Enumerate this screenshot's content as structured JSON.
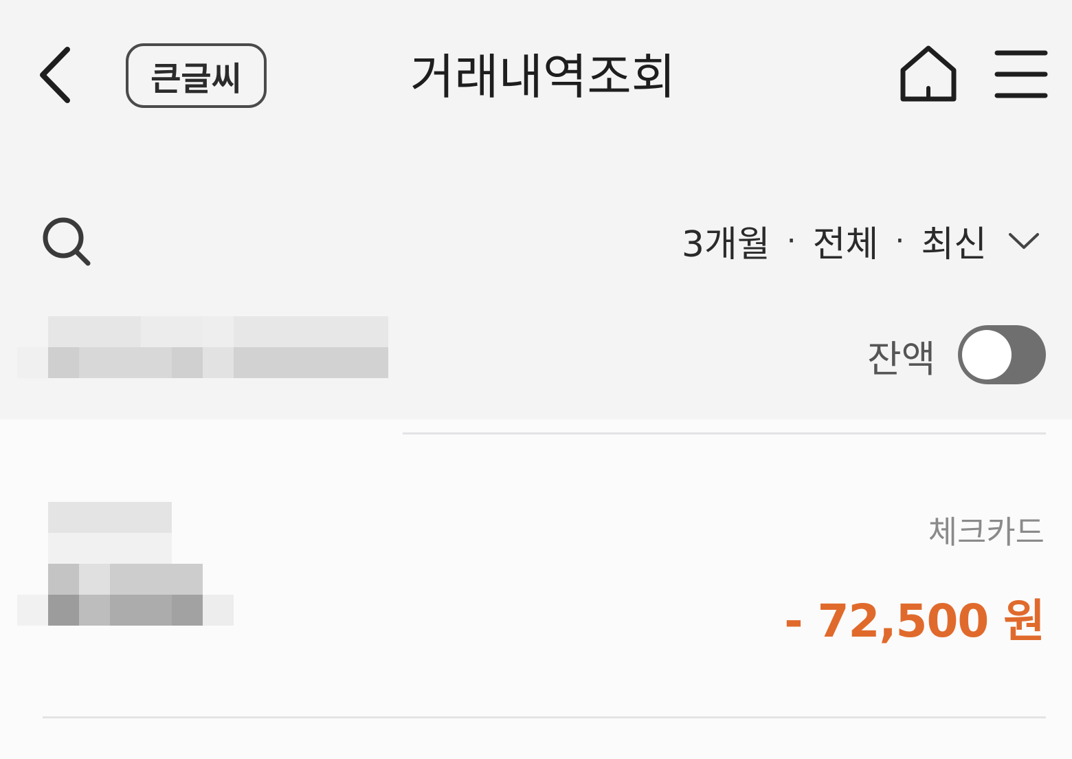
{
  "header": {
    "title": "거래내역조회",
    "bigfont_label": "큰글씨",
    "back_icon": "chevron-left-icon",
    "home_icon": "home-icon",
    "menu_icon": "hamburger-menu-icon"
  },
  "filter": {
    "search_icon": "search-icon",
    "period": "3개월",
    "type": "전체",
    "order": "최신",
    "separator": "·",
    "dropdown_icon": "chevron-down-icon"
  },
  "account": {
    "masked": true,
    "balance_label": "잔액",
    "balance_toggle_on": false
  },
  "transactions": [
    {
      "masked_description": true,
      "type": "체크카드",
      "amount": "- 72,500 원",
      "amount_color": "#e06a2c"
    }
  ],
  "colors": {
    "background": "#f4f4f5",
    "list_background": "#fbfbfb",
    "accent_negative": "#e06a2c",
    "toggle_off": "#6f6f6f"
  }
}
